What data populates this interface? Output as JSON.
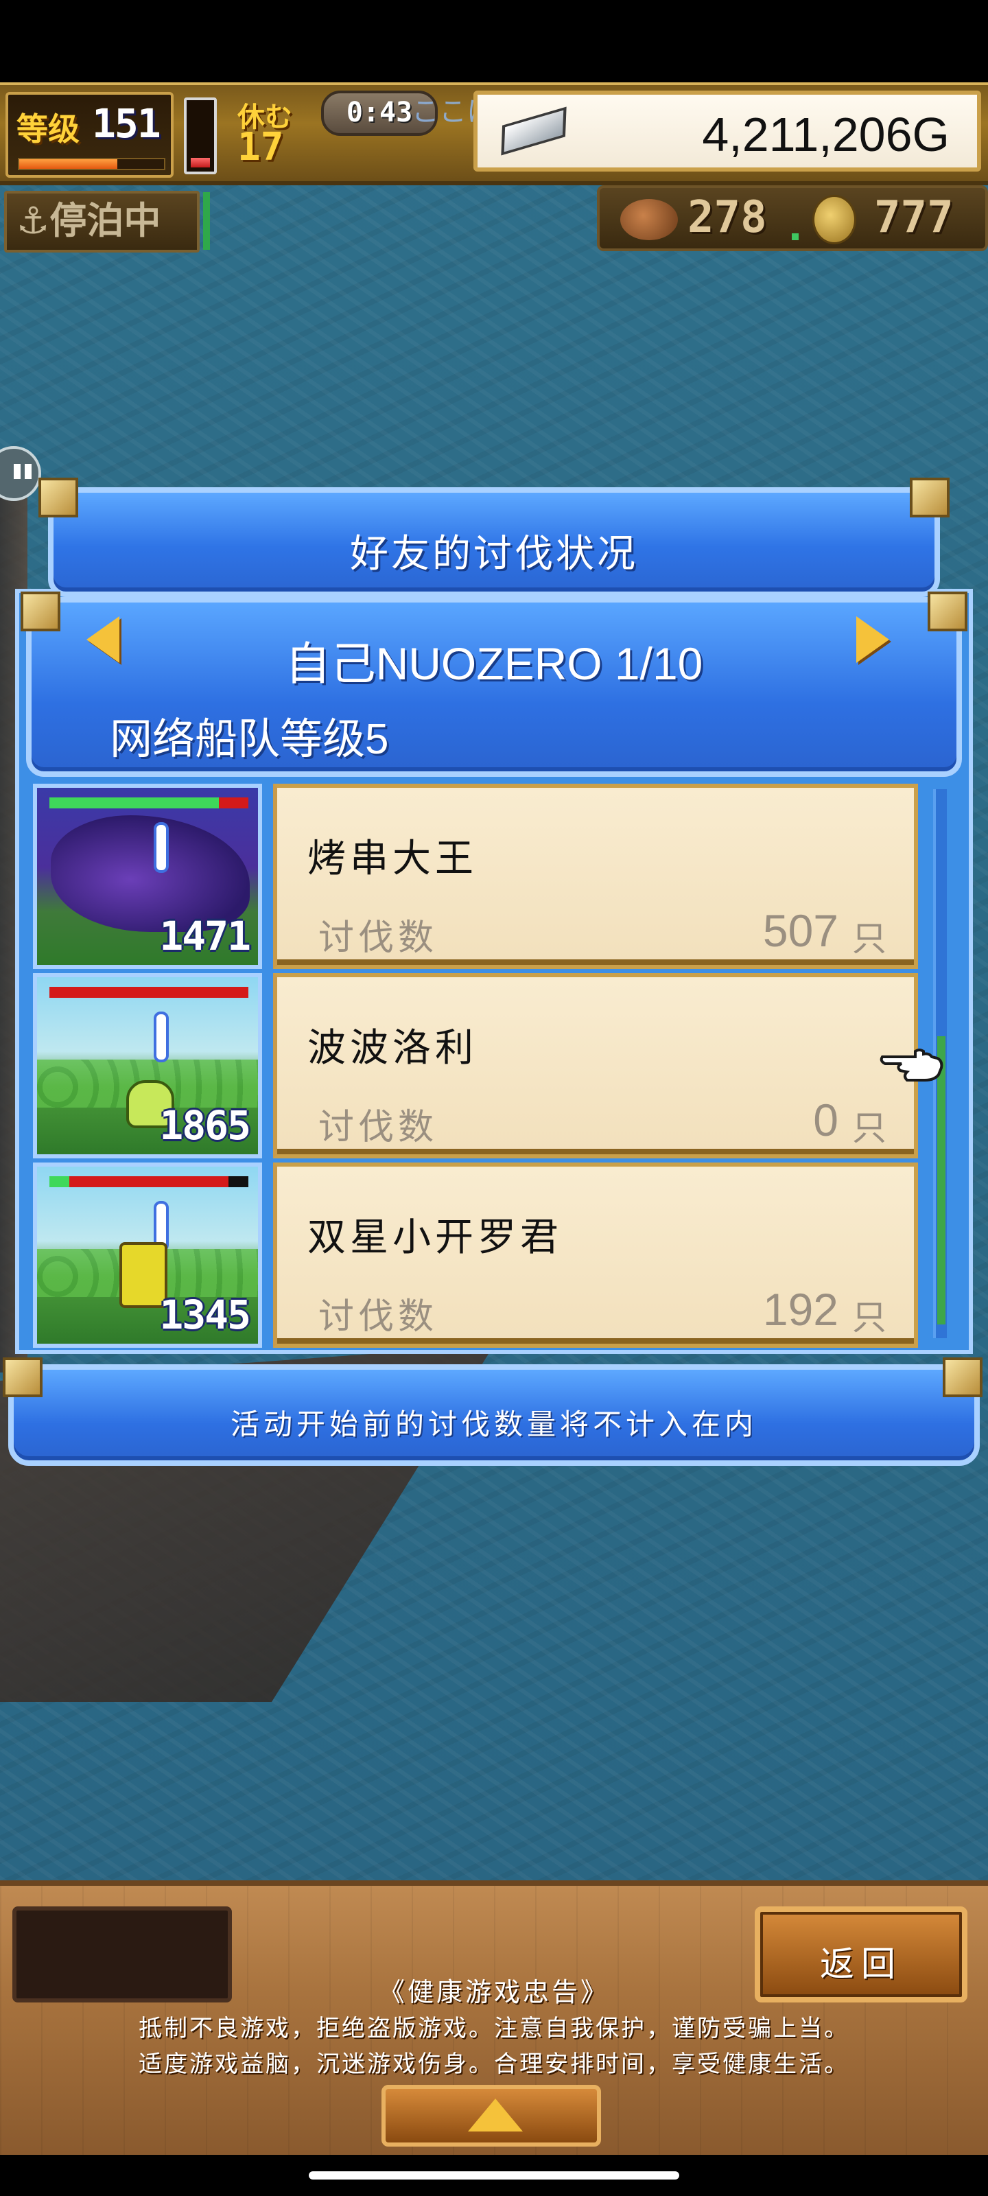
{
  "hud": {
    "level_label": "等级",
    "level": "151",
    "level_progress": 0.68,
    "stamina_fraction": 0.15,
    "rest_label": "休む",
    "rest_value": "17",
    "timer": "0:43",
    "location_hint": "ここにいる",
    "gold": "4,211,206G",
    "moor_status": "停泊中",
    "resource_a": "278",
    "resource_b": "777"
  },
  "dialog": {
    "title": "好友的讨伐状况",
    "self_line": "自己NUOZERO 1/10",
    "fleet_level": "网络船队等级5",
    "kill_label": "讨伐数",
    "unit": "只",
    "notice": "活动开始前的讨伐数量将不计入在内",
    "rows": [
      {
        "name": "烤串大王",
        "kills": "507",
        "power": "1471"
      },
      {
        "name": "波波洛利",
        "kills": "0",
        "power": "1865"
      },
      {
        "name": "双星小开罗君",
        "kills": "192",
        "power": "1345"
      }
    ]
  },
  "bottom": {
    "back_label": "返回",
    "advice_title": "《健康游戏忠告》",
    "advice_line1": "抵制不良游戏，拒绝盗版游戏。注意自我保护，谨防受骗上当。",
    "advice_line2": "适度游戏益脑，沉迷游戏伤身。合理安排时间，享受健康生活。"
  },
  "colors": {
    "panel_blue": "#2f74e6",
    "card_cream": "#f9ecd0",
    "gold_yellow": "#f5c23a"
  },
  "icons": [
    "ingot-icon",
    "ore-icon",
    "coin-icon",
    "anchor-icon",
    "arrow-left-icon",
    "arrow-right-icon",
    "pointer-hand-icon",
    "up-arrow-icon"
  ]
}
